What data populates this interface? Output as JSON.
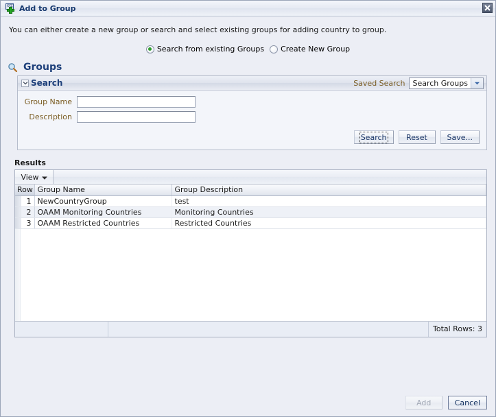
{
  "window": {
    "title": "Add to Group",
    "title_icon": "add-group-icon",
    "icon_text": "XYZ",
    "close_icon": "close-icon"
  },
  "intro": {
    "text": "You can either create a new group or search and select existing groups for adding country to group."
  },
  "mode_options": [
    {
      "label": "Search from existing Groups",
      "selected": true
    },
    {
      "label": "Create New Group",
      "selected": false
    }
  ],
  "groups_section": {
    "heading": "Groups",
    "icon": "magnifier-icon"
  },
  "search_panel": {
    "title": "Search",
    "disclosure_icon": "chevron-down-icon",
    "saved_search_label": "Saved Search",
    "saved_search_value": "Search Groups",
    "saved_search_arrow_icon": "chevron-down-icon",
    "fields": [
      {
        "label": "Group Name",
        "value": "",
        "placeholder": ""
      },
      {
        "label": "Description",
        "value": "",
        "placeholder": ""
      }
    ],
    "buttons": [
      {
        "label": "Search",
        "focused": true
      },
      {
        "label": "Reset",
        "focused": false
      },
      {
        "label": "Save...",
        "focused": false
      }
    ]
  },
  "results": {
    "label": "Results",
    "view_menu_label": "View",
    "view_menu_icon": "caret-down-icon",
    "columns": [
      "Row",
      "Group Name",
      "Group Description"
    ],
    "rows": [
      {
        "row": "1",
        "name": "NewCountryGroup",
        "description": "test"
      },
      {
        "row": "2",
        "name": "OAAM Monitoring Countries",
        "description": "Monitoring Countries"
      },
      {
        "row": "3",
        "name": "OAAM Restricted Countries",
        "description": "Restricted Countries"
      }
    ],
    "total_rows_text": "Total Rows: 3"
  },
  "dialog_buttons": [
    {
      "label": "Add",
      "disabled": true
    },
    {
      "label": "Cancel",
      "disabled": false
    }
  ],
  "colors": {
    "title_text": "#16386e",
    "label_text": "#7a5c22",
    "heading_blue": "#1d3f7a",
    "radio_dot": "#2f9c2f",
    "window_bg": "#eceef5"
  }
}
